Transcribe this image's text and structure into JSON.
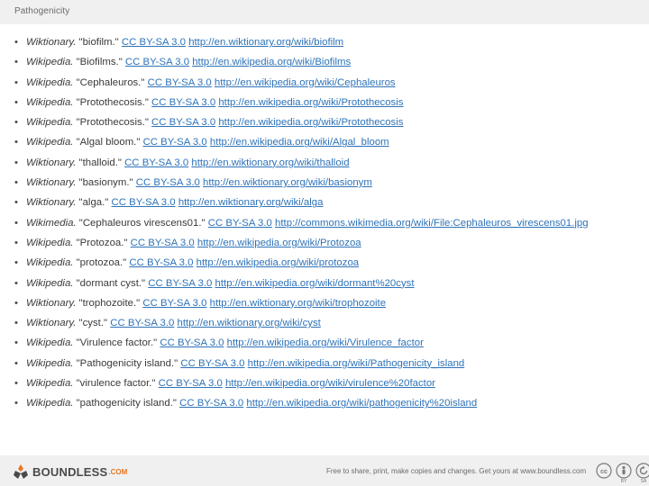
{
  "header": {
    "title": "Pathogenicity"
  },
  "references": [
    {
      "source": "Wiktionary.",
      "title": " \"biofilm.\" ",
      "license": "CC BY-SA 3.0",
      "url": "http://en.wiktionary.org/wiki/biofilm"
    },
    {
      "source": "Wikipedia.",
      "title": " \"Biofilms.\" ",
      "license": "CC BY-SA 3.0",
      "url": "http://en.wikipedia.org/wiki/Biofilms"
    },
    {
      "source": "Wikipedia.",
      "title": " \"Cephaleuros.\" ",
      "license": "CC BY-SA 3.0",
      "url": "http://en.wikipedia.org/wiki/Cephaleuros"
    },
    {
      "source": "Wikipedia.",
      "title": " \"Protothecosis.\" ",
      "license": "CC BY-SA 3.0",
      "url": "http://en.wikipedia.org/wiki/Protothecosis"
    },
    {
      "source": "Wikipedia.",
      "title": " \"Protothecosis.\" ",
      "license": "CC BY-SA 3.0",
      "url": "http://en.wikipedia.org/wiki/Protothecosis"
    },
    {
      "source": "Wikipedia.",
      "title": " \"Algal bloom.\" ",
      "license": "CC BY-SA 3.0",
      "url": "http://en.wikipedia.org/wiki/Algal_bloom"
    },
    {
      "source": "Wiktionary.",
      "title": " \"thalloid.\" ",
      "license": "CC BY-SA 3.0",
      "url": "http://en.wiktionary.org/wiki/thalloid"
    },
    {
      "source": "Wiktionary.",
      "title": " \"basionym.\" ",
      "license": "CC BY-SA 3.0",
      "url": "http://en.wiktionary.org/wiki/basionym"
    },
    {
      "source": "Wiktionary.",
      "title": " \"alga.\" ",
      "license": "CC BY-SA 3.0",
      "url": "http://en.wiktionary.org/wiki/alga"
    },
    {
      "source": "Wikimedia.",
      "title": " \"Cephaleuros virescens01.\" ",
      "license": "CC BY-SA 3.0",
      "url": "http://commons.wikimedia.org/wiki/File:Cephaleuros_virescens01.jpg"
    },
    {
      "source": "Wikipedia.",
      "title": " \"Protozoa.\" ",
      "license": "CC BY-SA 3.0",
      "url": "http://en.wikipedia.org/wiki/Protozoa"
    },
    {
      "source": "Wikipedia.",
      "title": " \"protozoa.\" ",
      "license": "CC BY-SA 3.0",
      "url": "http://en.wikipedia.org/wiki/protozoa"
    },
    {
      "source": "Wikipedia.",
      "title": " \"dormant cyst.\" ",
      "license": "CC BY-SA 3.0",
      "url": "http://en.wikipedia.org/wiki/dormant%20cyst"
    },
    {
      "source": "Wiktionary.",
      "title": " \"trophozoite.\" ",
      "license": "CC BY-SA 3.0",
      "url": "http://en.wiktionary.org/wiki/trophozoite"
    },
    {
      "source": "Wiktionary.",
      "title": " \"cyst.\" ",
      "license": "CC BY-SA 3.0",
      "url": "http://en.wiktionary.org/wiki/cyst"
    },
    {
      "source": "Wikipedia.",
      "title": " \"Virulence factor.\" ",
      "license": "CC BY-SA 3.0",
      "url": "http://en.wikipedia.org/wiki/Virulence_factor"
    },
    {
      "source": "Wikipedia.",
      "title": " \"Pathogenicity island.\" ",
      "license": "CC BY-SA 3.0",
      "url": "http://en.wikipedia.org/wiki/Pathogenicity_island"
    },
    {
      "source": "Wikipedia.",
      "title": " \"virulence factor.\" ",
      "license": "CC BY-SA 3.0",
      "url": "http://en.wikipedia.org/wiki/virulence%20factor"
    },
    {
      "source": "Wikipedia.",
      "title": " \"pathogenicity island.\" ",
      "license": "CC BY-SA 3.0",
      "url": "http://en.wikipedia.org/wiki/pathogenicity%20island"
    }
  ],
  "footer": {
    "logo_text": "BOUNDLESS",
    "logo_domain": ".COM",
    "note": "Free to share, print, make copies and changes. Get yours at www.boundless.com",
    "cc_labels": [
      "BY",
      "SA"
    ],
    "icons": [
      "boundless-logo-icon",
      "cc-icon",
      "by-icon",
      "sa-icon"
    ]
  },
  "colors": {
    "link": "#2e73b8",
    "band": "#f0f0f0",
    "logo_accent": "#e87722"
  }
}
